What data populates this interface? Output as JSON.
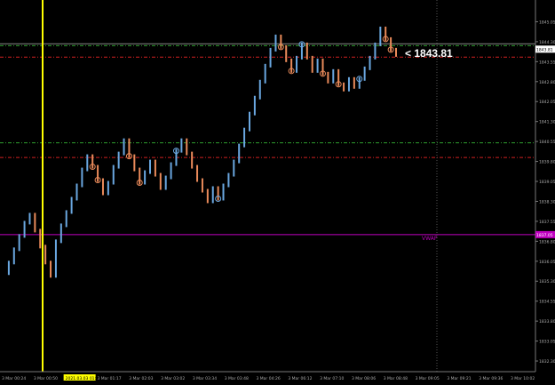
{
  "chart_data": {
    "type": "candlestick-line",
    "instrument_current_price": "1843.81",
    "callout_text": "< 1843.81",
    "y_axis_ticks": [
      "1845.05",
      "1844.30",
      "1843.55",
      "1842.80",
      "1842.05",
      "1841.30",
      "1840.55",
      "1839.80",
      "1839.05",
      "1838.30",
      "1837.55",
      "1836.80",
      "1836.05",
      "1835.30",
      "1834.55",
      "1833.80",
      "1833.05",
      "1832.30"
    ],
    "x_axis_ticks": [
      "3 Mar 00:24",
      "3 Mar 00:50",
      "2021.03.03 01:03",
      "3 Mar 01:17",
      "3 Mar 02:03",
      "3 Mar 03:02",
      "3 Mar 03:34",
      "3 Mar 03:48",
      "3 Mar 04:26",
      "3 Mar 06:12",
      "3 Mar 07:10",
      "3 Mar 08:06",
      "3 Mar 08:48",
      "3 Mar 09:05",
      "3 Mar 09:21",
      "3 Mar 09:36",
      "3 Mar 10:02"
    ],
    "current_price_tag": "1843.81",
    "vwap_label": "VWAP",
    "vwap_tag": "1837.05",
    "ylim": [
      1831.9,
      1845.6
    ],
    "up_color": "#6aa7e0",
    "down_color": "#e98a5a",
    "series": [
      {
        "values": [
          1835.6,
          1836.0,
          1836.5,
          1837.0,
          1837.5,
          1837.8,
          1837.2,
          1836.6,
          1836.0,
          1835.5,
          1836.8,
          1837.4,
          1837.9,
          1838.4,
          1838.9,
          1839.5,
          1840.0,
          1839.6,
          1839.1,
          1838.6,
          1839.0,
          1839.6,
          1840.1,
          1840.6,
          1840.0,
          1839.5,
          1839.0,
          1839.4,
          1839.8,
          1839.3,
          1838.8,
          1839.2,
          1839.7,
          1840.2,
          1840.6,
          1840.1,
          1839.6,
          1839.1,
          1838.7,
          1838.3,
          1838.8,
          1838.4,
          1838.9,
          1839.3,
          1839.8,
          1840.4,
          1841.0,
          1841.6,
          1842.2,
          1842.8,
          1843.4,
          1844.0,
          1844.5,
          1844.1,
          1843.6,
          1843.2,
          1843.7,
          1844.2,
          1843.7,
          1843.2,
          1843.6,
          1843.1,
          1842.8,
          1843.2,
          1842.7,
          1842.5,
          1842.9,
          1842.6,
          1842.9,
          1843.3,
          1843.7,
          1844.2,
          1844.8,
          1844.4,
          1844.0,
          1843.8
        ]
      }
    ]
  }
}
